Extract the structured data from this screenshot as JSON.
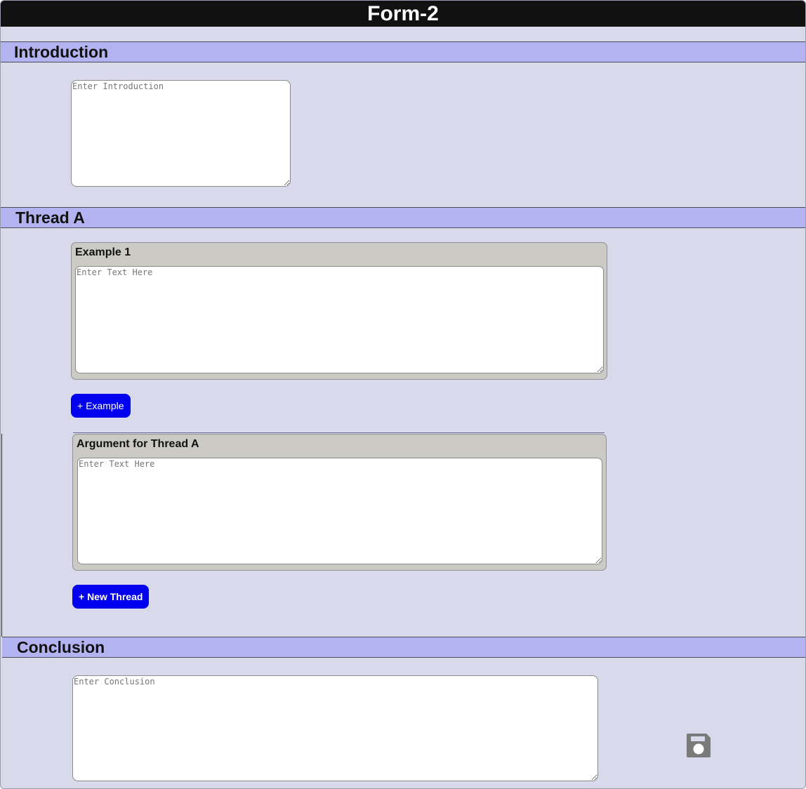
{
  "title": "Form-2",
  "sections": {
    "introduction": {
      "header": "Introduction",
      "placeholder": "Enter Introduction"
    },
    "thread_a": {
      "header": "Thread A",
      "example": {
        "title": "Example 1",
        "placeholder": "Enter Text Here"
      },
      "add_example_label": "+ Example",
      "argument": {
        "title": "Argument for Thread A",
        "placeholder": "Enter Text Here"
      },
      "new_thread_label": "+ New Thread"
    },
    "conclusion": {
      "header": "Conclusion",
      "placeholder": "Enter Conclusion"
    }
  },
  "icons": {
    "save": "floppy-disk-icon"
  },
  "colors": {
    "title_bar": "#111111",
    "section_header": "#b3b3f2",
    "page_background": "#d9d9ec",
    "card_background": "#cbcac4",
    "button": "#0000ee"
  }
}
